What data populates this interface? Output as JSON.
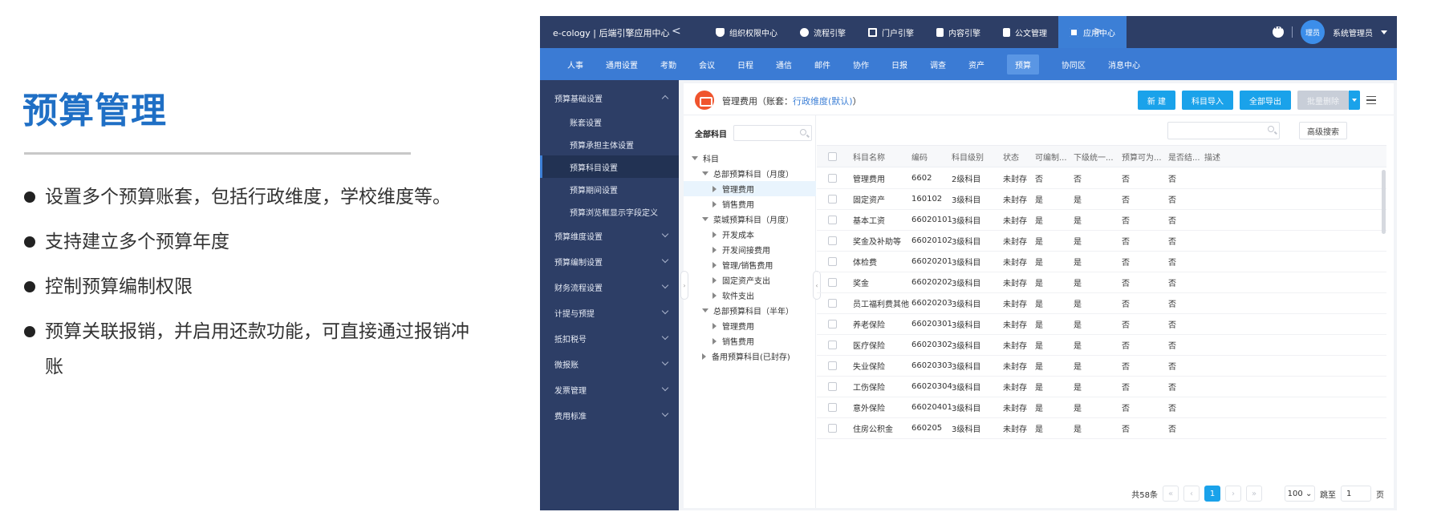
{
  "slide": {
    "title": "预算管理",
    "bullets": [
      "设置多个预算账套，包括行政维度，学校维度等。",
      "支持建立多个预算年度",
      "控制预算编制权限",
      "预算关联报销，并启用还款功能，可直接通过报销冲账"
    ]
  },
  "app": {
    "brand": "e-cology | 后端引擎应用中心",
    "prev_arrow": "<",
    "next_arrow": ">",
    "modules": [
      "组织权限中心",
      "流程引擎",
      "门户引擎",
      "内容引擎",
      "公文管理",
      "应用中心"
    ],
    "active_module": "应用中心",
    "avatar_text": "理员",
    "username": "系统管理员",
    "subnav": [
      "人事",
      "通用设置",
      "考勤",
      "会议",
      "日程",
      "通信",
      "邮件",
      "协作",
      "日报",
      "调查",
      "资产",
      "预算",
      "协同区",
      "消息中心"
    ],
    "active_subnav": "预算",
    "sidebar": [
      {
        "label": "预算基础设置",
        "type": "group",
        "expanded": true
      },
      {
        "label": "账套设置",
        "type": "sub"
      },
      {
        "label": "预算承担主体设置",
        "type": "sub"
      },
      {
        "label": "预算科目设置",
        "type": "sub",
        "active": true
      },
      {
        "label": "预算期间设置",
        "type": "sub"
      },
      {
        "label": "预算浏览框显示字段定义",
        "type": "sub"
      },
      {
        "label": "预算维度设置",
        "type": "group"
      },
      {
        "label": "预算编制设置",
        "type": "group"
      },
      {
        "label": "财务流程设置",
        "type": "group"
      },
      {
        "label": "计提与预提",
        "type": "group"
      },
      {
        "label": "抵扣税号",
        "type": "group"
      },
      {
        "label": "微报账",
        "type": "group"
      },
      {
        "label": "发票管理",
        "type": "group"
      },
      {
        "label": "费用标准",
        "type": "group"
      }
    ],
    "panel": {
      "title_prefix": "管理费用（账套：",
      "title_link": "行政维度(默认)",
      "title_suffix": "）",
      "buttons": [
        "新 建",
        "科目导入",
        "全部导出"
      ],
      "batch_delete": "批量删除"
    },
    "tree": {
      "label": "全部科目",
      "nodes": [
        {
          "label": "科目",
          "level": 0,
          "state": "open"
        },
        {
          "label": "总部预算科目（月度）",
          "level": 1,
          "state": "open"
        },
        {
          "label": "管理费用",
          "level": 2,
          "state": "closed",
          "selected": true
        },
        {
          "label": "销售费用",
          "level": 2,
          "state": "closed"
        },
        {
          "label": "菜城预算科目（月度）",
          "level": 1,
          "state": "open"
        },
        {
          "label": "开发成本",
          "level": 2,
          "state": "closed"
        },
        {
          "label": "开发间接费用",
          "level": 2,
          "state": "closed"
        },
        {
          "label": "管理/销售费用",
          "level": 2,
          "state": "closed"
        },
        {
          "label": "固定资产支出",
          "level": 2,
          "state": "closed"
        },
        {
          "label": "软件支出",
          "level": 2,
          "state": "closed"
        },
        {
          "label": "总部预算科目（半年）",
          "level": 1,
          "state": "open"
        },
        {
          "label": "管理费用",
          "level": 2,
          "state": "closed"
        },
        {
          "label": "销售费用",
          "level": 2,
          "state": "closed"
        },
        {
          "label": "备用预算科目(已封存)",
          "level": 1,
          "state": "closed"
        }
      ]
    },
    "grid": {
      "advanced_search": "高级搜索",
      "columns": [
        "科目名称",
        "编码",
        "科目级别",
        "状态",
        "可编制...",
        "下级统一...",
        "预算可为...",
        "是否结...",
        "描述"
      ],
      "rows": [
        [
          "管理费用",
          "6602",
          "2级科目",
          "未封存",
          "否",
          "否",
          "否",
          "否",
          ""
        ],
        [
          "固定资产",
          "160102",
          "3级科目",
          "未封存",
          "是",
          "是",
          "否",
          "否",
          ""
        ],
        [
          "基本工资",
          "66020101",
          "3级科目",
          "未封存",
          "是",
          "是",
          "否",
          "否",
          ""
        ],
        [
          "奖金及补助等",
          "66020102",
          "3级科目",
          "未封存",
          "是",
          "是",
          "否",
          "否",
          ""
        ],
        [
          "体检费",
          "66020201",
          "3级科目",
          "未封存",
          "是",
          "是",
          "否",
          "否",
          ""
        ],
        [
          "奖金",
          "66020202",
          "3级科目",
          "未封存",
          "是",
          "是",
          "否",
          "否",
          ""
        ],
        [
          "员工福利费其他",
          "66020203",
          "3级科目",
          "未封存",
          "是",
          "是",
          "否",
          "否",
          ""
        ],
        [
          "养老保险",
          "66020301",
          "3级科目",
          "未封存",
          "是",
          "是",
          "否",
          "否",
          ""
        ],
        [
          "医疗保险",
          "66020302",
          "3级科目",
          "未封存",
          "是",
          "是",
          "否",
          "否",
          ""
        ],
        [
          "失业保险",
          "66020303",
          "3级科目",
          "未封存",
          "是",
          "是",
          "否",
          "否",
          ""
        ],
        [
          "工伤保险",
          "66020304",
          "3级科目",
          "未封存",
          "是",
          "是",
          "否",
          "否",
          ""
        ],
        [
          "意外保险",
          "66020401",
          "3级科目",
          "未封存",
          "是",
          "是",
          "否",
          "否",
          ""
        ],
        [
          "住房公积金",
          "660205",
          "3级科目",
          "未封存",
          "是",
          "是",
          "否",
          "否",
          ""
        ]
      ]
    },
    "pager": {
      "total": "共58条",
      "current_page": "1",
      "page_size": "100",
      "jump_label": "跳至",
      "jump_value": "1",
      "page_unit": "页"
    }
  }
}
